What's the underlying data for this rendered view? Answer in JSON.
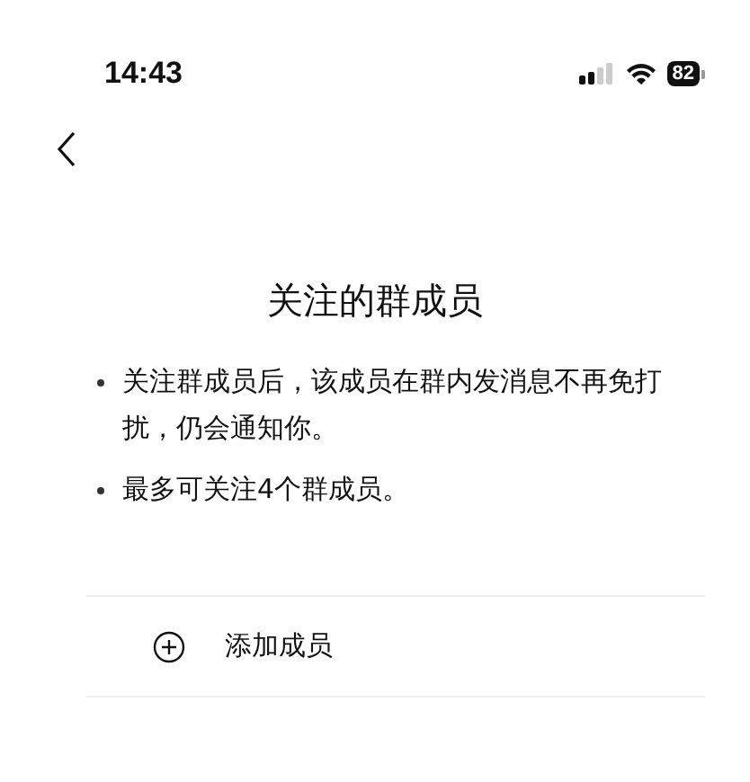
{
  "status_bar": {
    "time": "14:43",
    "battery": "82"
  },
  "title": "关注的群成员",
  "notes": [
    "关注群成员后，该成员在群内发消息不再免打扰，仍会通知你。",
    "最多可关注4个群成员。"
  ],
  "add_row": {
    "label": "添加成员"
  }
}
